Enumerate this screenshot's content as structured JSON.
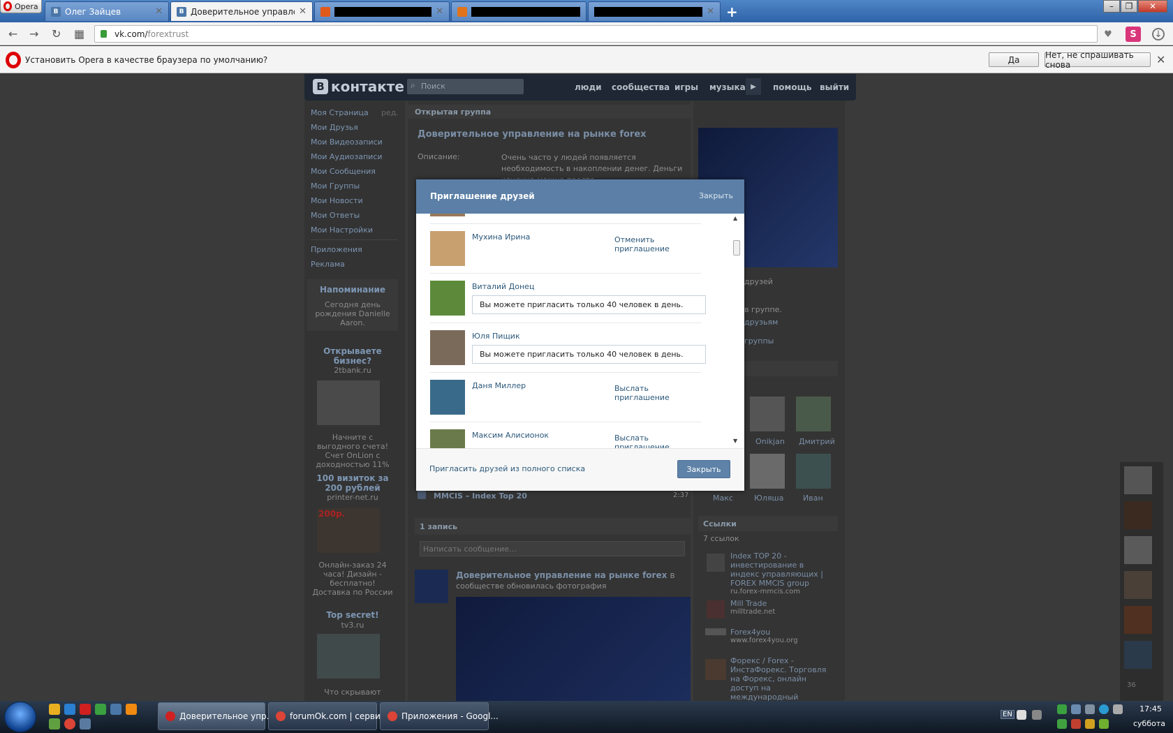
{
  "browser": {
    "opera_button": "Opera",
    "tabs": [
      {
        "label": "Олег Зайцев",
        "icon": "В"
      },
      {
        "label": "Доверительное управлени",
        "icon": "В"
      },
      {
        "label": "",
        "icon": ""
      },
      {
        "label": "",
        "icon": ""
      },
      {
        "label": "",
        "icon": ""
      }
    ],
    "url_host": "vk.com/",
    "url_path": "forextrust",
    "infobar": {
      "text": "Установить Opera в качестве браузера по умолчанию?",
      "yes": "Да",
      "no": "Нет, не спрашивать снова"
    }
  },
  "vk": {
    "logo_text": "контакте",
    "logo_letter": "В",
    "search_placeholder": "Поиск",
    "nav": [
      "люди",
      "сообщества",
      "игры",
      "музыка",
      "помощь",
      "выйти"
    ],
    "left_menu": [
      "Моя Страница",
      "Мои Друзья",
      "Мои Видеозаписи",
      "Мои Аудиозаписи",
      "Мои Сообщения",
      "Мои Группы",
      "Мои Новости",
      "Мои Ответы",
      "Мои Настройки"
    ],
    "left_menu2": [
      "Приложения",
      "Реклама"
    ],
    "edit_link": "ред.",
    "reminder_title": "Напоминание",
    "reminder_text": "Сегодня день рождения Danielle Aaron.",
    "ads": [
      {
        "title": "Открываете бизнес?",
        "domain": "2tbank.ru",
        "text": "Начните с выгодного счета! Счет OnLion с доходностью 11%"
      },
      {
        "title": "100 визиток за 200 рублей",
        "domain": "printer-net.ru",
        "text": "Онлайн-заказ 24 часа! Дизайн - бесплатно! Доставка по России"
      },
      {
        "title": "Top secret!",
        "domain": "tv3.ru",
        "text": "Что скрывают"
      }
    ],
    "ad_price_badge": "200р.",
    "group_type": "Открытая группа",
    "group_name": "Доверительное управление на рынке forex",
    "desc_label": "Описание:",
    "desc_text": "Очень часто у людей появляется необходимость в накоплении денег. Деньги конечно можно просто",
    "audio_title": "MMCIS – Index Top 20",
    "audio_time": "2:37",
    "posts_count": "1 запись",
    "write_placeholder": "Написать сообщение...",
    "post_author": "Доверительное управление на рынке forex",
    "post_in": "в",
    "post_text": "сообществе обновилась фотография",
    "right_frag": [
      "друзей",
      "в группе.",
      "друзьям",
      "группы"
    ],
    "members": [
      "Onikjan",
      "Дмитрий",
      "Макс",
      "Юляша",
      "Иван"
    ],
    "links_title": "Ссылки",
    "links_count": "7 ссылок",
    "links": [
      {
        "title": "Index TOP 20 - инвестирование в индекс управляющих | FOREX MMCIS group",
        "url": "ru.forex-mmcis.com"
      },
      {
        "title": "Mill Trade",
        "url": "milltrade.net"
      },
      {
        "title": "Forex4you",
        "url": "www.forex4you.org"
      },
      {
        "title": "Форекс / Forex - ИнстаФорекс. Торговля на Форекс, онлайн доступ на международный валютный рынок Forex",
        "url": ""
      }
    ],
    "strip_count": "36"
  },
  "modal": {
    "title": "Приглашение друзей",
    "close_top": "Закрыть",
    "friends": [
      {
        "name": "Мухина Ирина",
        "action": "Отменить приглашение",
        "limit": ""
      },
      {
        "name": "Виталий Донец",
        "action": "",
        "limit": "Вы можете пригласить только 40 человек в день."
      },
      {
        "name": "Юля Пищик",
        "action": "",
        "limit": "Вы можете пригласить только 40 человек в день."
      },
      {
        "name": "Даня Миллер",
        "action": "Выслать приглашение",
        "limit": ""
      },
      {
        "name": "Максим Алисионок",
        "action": "Выслать приглашение",
        "limit": ""
      }
    ],
    "invite_full": "Пригласить друзей из полного списка",
    "close_button": "Закрыть"
  },
  "taskbar": {
    "buttons": [
      "Доверительное упр...",
      "forumOk.com | серви...",
      "Приложения - Googl..."
    ],
    "lang": "EN",
    "time": "17:45",
    "day": "суббота"
  },
  "colors": {
    "vk_header": "#1e2733",
    "modal_header": "#5b7fa6",
    "link": "#2b587a",
    "button": "#5e82a8"
  }
}
